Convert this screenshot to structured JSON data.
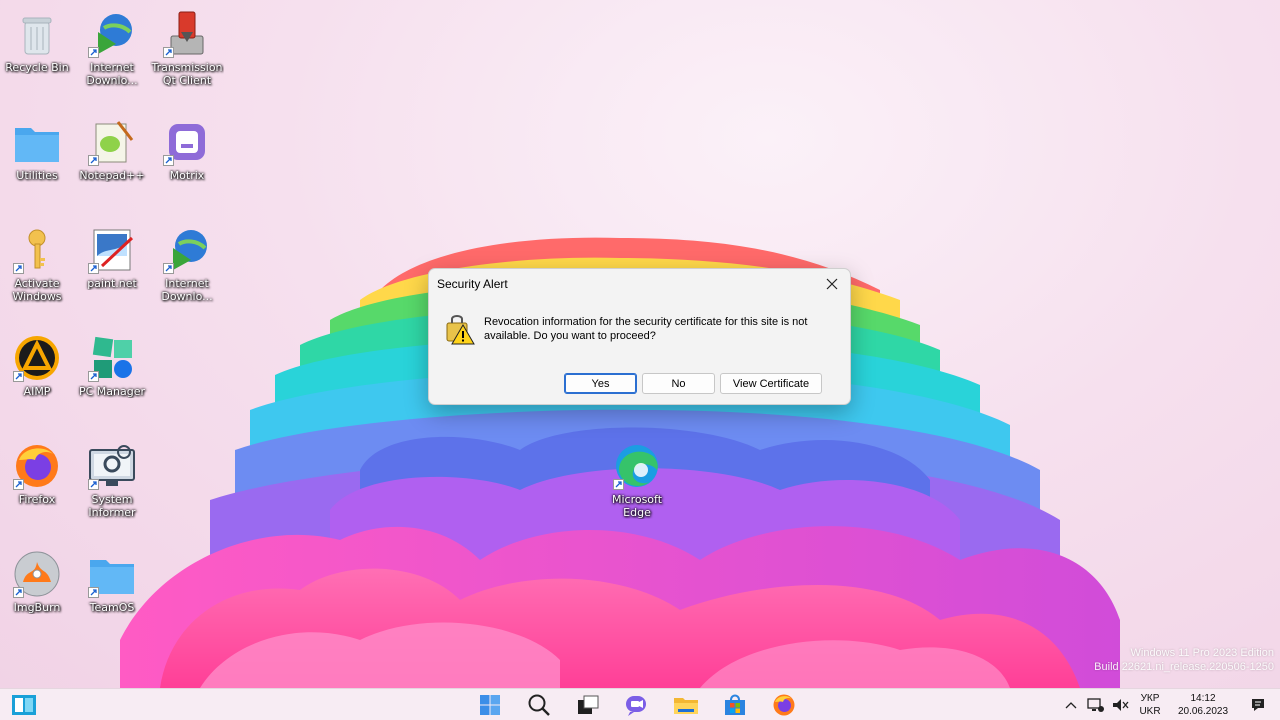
{
  "desktop": {
    "icons": [
      {
        "label": "Recycle Bin",
        "icon": "recycle-bin-icon"
      },
      {
        "label": "Internet Downlo...",
        "icon": "internet-download-manager-icon"
      },
      {
        "label": "Transmission Qt Client",
        "icon": "transmission-icon"
      },
      {
        "label": "Utilities",
        "icon": "folder-icon"
      },
      {
        "label": "Notepad++",
        "icon": "notepad-plus-plus-icon"
      },
      {
        "label": "Motrix",
        "icon": "motrix-icon"
      },
      {
        "label": "Activate Windows",
        "icon": "key-icon"
      },
      {
        "label": "paint.net",
        "icon": "paint-net-icon"
      },
      {
        "label": "Internet Downlo...",
        "icon": "internet-download-manager-icon"
      },
      {
        "label": "AIMP",
        "icon": "aimp-icon"
      },
      {
        "label": "PC Manager",
        "icon": "pc-manager-icon"
      },
      {
        "label": "Firefox",
        "icon": "firefox-icon"
      },
      {
        "label": "System Informer",
        "icon": "system-informer-icon"
      },
      {
        "label": "ImgBurn",
        "icon": "imgburn-icon"
      },
      {
        "label": "TeamOS",
        "icon": "folder-icon"
      },
      {
        "label": "Microsoft Edge",
        "icon": "edge-icon"
      }
    ]
  },
  "dialog": {
    "title": "Security Alert",
    "message": "Revocation information for the security certificate for this site is not available. Do you want to proceed?",
    "buttons": {
      "yes": "Yes",
      "no": "No",
      "view": "View Certificate"
    }
  },
  "watermark": {
    "line1": "Windows 11 Pro 2023 Edition",
    "line2": "Build 22621.ni_release.220506-1250"
  },
  "taskbar": {
    "apps": [
      "start-icon",
      "search-icon",
      "task-view-icon",
      "teams-chat-icon",
      "file-explorer-icon",
      "microsoft-store-icon",
      "firefox-icon"
    ],
    "tray": {
      "lang_top": "УКР",
      "lang_bottom": "UKR",
      "time": "14:12",
      "date": "20.06.2023"
    }
  },
  "colors": {
    "accent": "#2b6fd1",
    "taskbar_bg": "#f7ecf3",
    "dialog_bg": "#f3f3f3"
  }
}
